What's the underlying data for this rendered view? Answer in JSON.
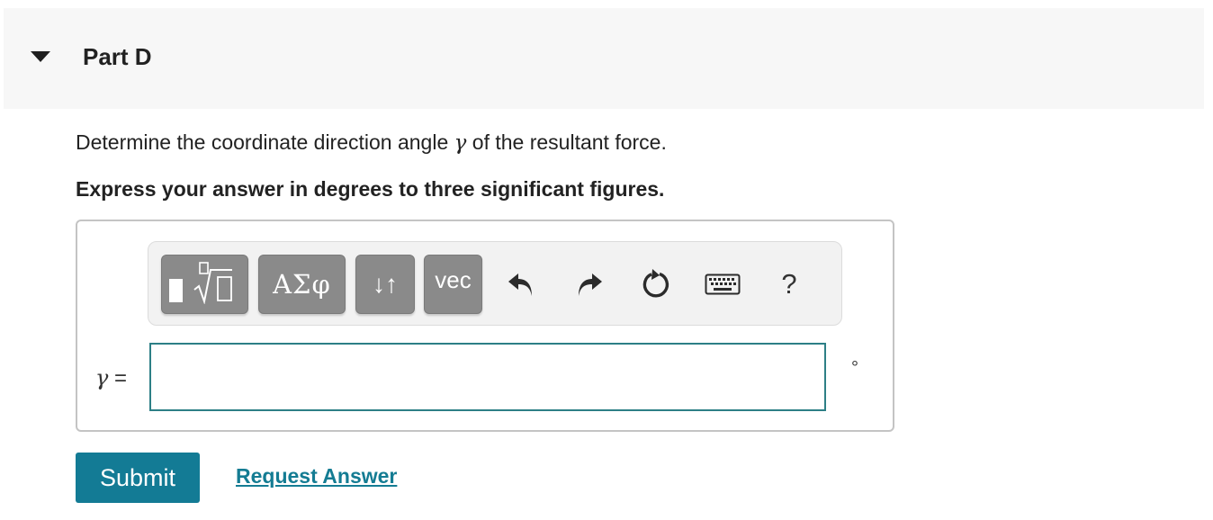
{
  "part": {
    "title": "Part D",
    "toggle_icon": "caret-down-icon"
  },
  "question": {
    "prompt_before": "Determine the coordinate direction angle ",
    "prompt_symbol": "γ",
    "prompt_after": " of the resultant force.",
    "instruction": "Express your answer in degrees to three significant figures."
  },
  "toolbar": {
    "templates_icon": "templates-radical-icon",
    "greek_label": "ΑΣφ",
    "arrows_label": "↓↑",
    "vec_label": "vec",
    "undo_icon": "undo-icon",
    "redo_icon": "redo-icon",
    "reset_icon": "reset-icon",
    "keyboard_icon": "keyboard-icon",
    "help_label": "?"
  },
  "answer": {
    "variable": "γ",
    "equals": "=",
    "value": "",
    "unit": "°"
  },
  "actions": {
    "submit_label": "Submit",
    "request_label": "Request Answer"
  },
  "colors": {
    "primary": "#137b95",
    "link": "#147c93",
    "input_border": "#2d7f86",
    "tool_button": "#8a8a8a",
    "header_bg": "#f7f7f7"
  }
}
